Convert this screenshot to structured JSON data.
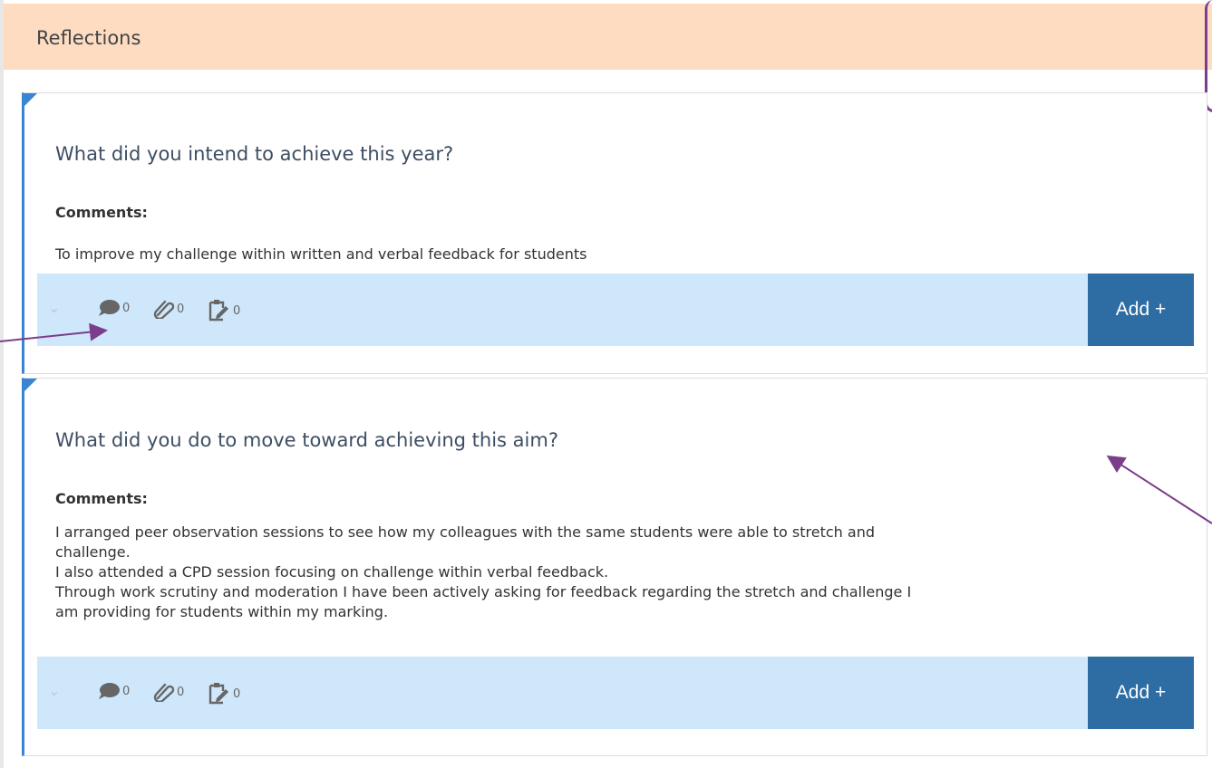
{
  "header": {
    "title": "Reflections"
  },
  "cards": [
    {
      "question": "What did you intend to achieve this year?",
      "comments_label": "Comments:",
      "comment_lines": [
        "To improve my challenge within written and verbal feedback for students"
      ],
      "counts": {
        "comments": "0",
        "attachments": "0",
        "tasks": "0"
      },
      "add_label": "Add +"
    },
    {
      "question": "What did you do to move toward achieving this aim?",
      "comments_label": "Comments:",
      "comment_lines": [
        "I arranged peer observation sessions to see how my colleagues with the same students were able to stretch and",
        "challenge.",
        "I also attended a CPD session focusing on challenge within verbal feedback.",
        "Through work scrutiny and moderation I have been actively asking for feedback regarding the stretch and challenge I",
        "am providing for students within my marking."
      ],
      "counts": {
        "comments": "0",
        "attachments": "0",
        "tasks": "0"
      },
      "add_label": "Add +"
    }
  ],
  "icons": {
    "chevron": "chevron-down-icon",
    "comments": "speech-bubble-icon",
    "attachments": "paperclip-icon",
    "tasks": "edit-clipboard-icon"
  },
  "colors": {
    "header_bg": "#fddcc2",
    "card_accent": "#3a84d4",
    "toolbar_bg": "#cfe7fb",
    "add_button": "#2e6da4",
    "annotation": "#7b3e8a"
  }
}
